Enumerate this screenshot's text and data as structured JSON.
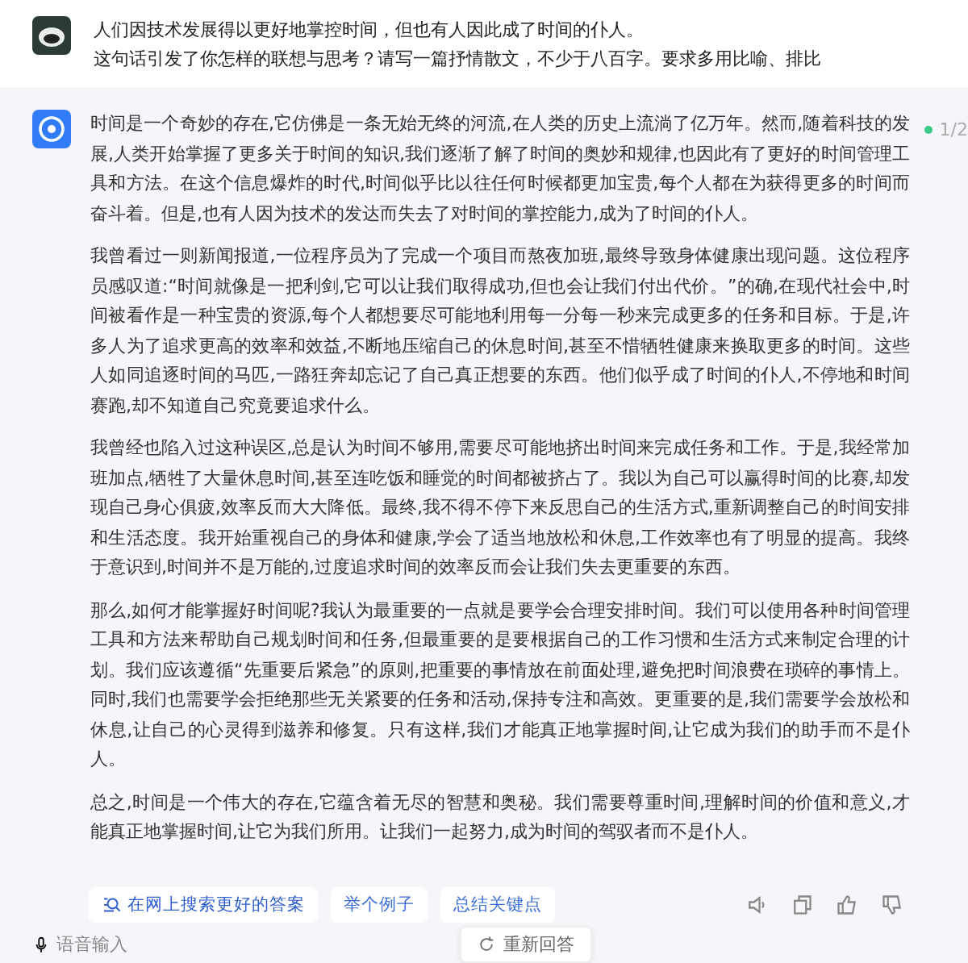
{
  "user_message": {
    "lines": [
      "人们因技术发展得以更好地掌控时间，但也有人因此成了时间的仆人。",
      "这句话引发了你怎样的联想与思考？请写一篇抒情散文，不少于八百字。要求多用比喻、排比"
    ]
  },
  "assistant_message": {
    "counter": "1/2",
    "paragraphs": [
      "时间是一个奇妙的存在,它仿佛是一条无始无终的河流,在人类的历史上流淌了亿万年。然而,随着科技的发展,人类开始掌握了更多关于时间的知识,我们逐渐了解了时间的奥妙和规律,也因此有了更好的时间管理工具和方法。在这个信息爆炸的时代,时间似乎比以往任何时候都更加宝贵,每个人都在为获得更多的时间而奋斗着。但是,也有人因为技术的发达而失去了对时间的掌控能力,成为了时间的仆人。",
      "我曾看过一则新闻报道,一位程序员为了完成一个项目而熬夜加班,最终导致身体健康出现问题。这位程序员感叹道:“时间就像是一把利剑,它可以让我们取得成功,但也会让我们付出代价。”的确,在现代社会中,时间被看作是一种宝贵的资源,每个人都想要尽可能地利用每一分每一秒来完成更多的任务和目标。于是,许多人为了追求更高的效率和效益,不断地压缩自己的休息时间,甚至不惜牺牲健康来换取更多的时间。这些人如同追逐时间的马匹,一路狂奔却忘记了自己真正想要的东西。他们似乎成了时间的仆人,不停地和时间赛跑,却不知道自己究竟要追求什么。",
      "我曾经也陷入过这种误区,总是认为时间不够用,需要尽可能地挤出时间来完成任务和工作。于是,我经常加班加点,牺牲了大量休息时间,甚至连吃饭和睡觉的时间都被挤占了。我以为自己可以赢得时间的比赛,却发现自己身心俱疲,效率反而大大降低。最终,我不得不停下来反思自己的生活方式,重新调整自己的时间安排和生活态度。我开始重视自己的身体和健康,学会了适当地放松和休息,工作效率也有了明显的提高。我终于意识到,时间并不是万能的,过度追求时间的效率反而会让我们失去更重要的东西。",
      "那么,如何才能掌握好时间呢?我认为最重要的一点就是要学会合理安排时间。我们可以使用各种时间管理工具和方法来帮助自己规划时间和任务,但最重要的是要根据自己的工作习惯和生活方式来制定合理的计划。我们应该遵循“先重要后紧急”的原则,把重要的事情放在前面处理,避免把时间浪费在琐碎的事情上。同时,我们也需要学会拒绝那些无关紧要的任务和活动,保持专注和高效。更重要的是,我们需要学会放松和休息,让自己的心灵得到滋养和修复。只有这样,我们才能真正地掌握时间,让它成为我们的助手而不是仆人。",
      "总之,时间是一个伟大的存在,它蕴含着无尽的智慧和奥秘。我们需要尊重时间,理解时间的价值和意义,才能真正地掌握时间,让它为我们所用。让我们一起努力,成为时间的驾驭者而不是仆人。"
    ]
  },
  "suggestions": [
    {
      "label": "在网上搜索更好的答案",
      "kind": "search"
    },
    {
      "label": "举个例子",
      "kind": "plain"
    },
    {
      "label": "总结关键点",
      "kind": "plain"
    }
  ],
  "regenerate_button": "重新回答",
  "voice_input": "语音输入"
}
